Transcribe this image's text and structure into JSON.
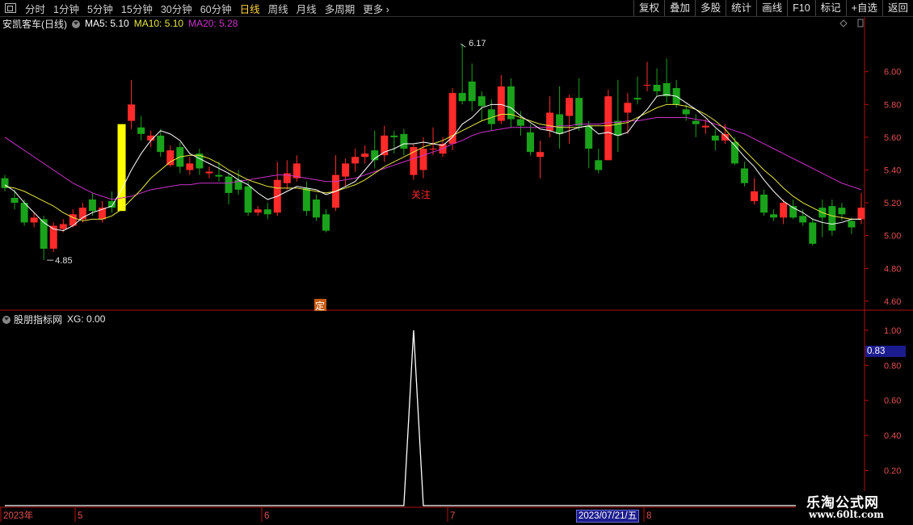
{
  "toolbar": {
    "periods": [
      "分时",
      "1分钟",
      "5分钟",
      "15分钟",
      "30分钟",
      "60分钟",
      "日线",
      "周线",
      "月线",
      "多周期",
      "更多"
    ],
    "active_period": "日线",
    "right_buttons": [
      "复权",
      "叠加",
      "多股",
      "统计",
      "画线",
      "F10",
      "标记",
      "+自选",
      "返回"
    ]
  },
  "title": {
    "stock": "安凯客车(日线)",
    "ma5": "MA5: 5.10",
    "ma10": "MA10: 5.10",
    "ma20": "MA20: 5.28"
  },
  "indicator": {
    "name": "股朋指标网",
    "xg": "XG: 0.00",
    "current_value": "0.83"
  },
  "colors": {
    "up": "#ff2a2a",
    "down": "#1aa31a",
    "ma5": "#ffffff",
    "ma10": "#e6e640",
    "ma20": "#cc33cc",
    "highlight": "#ffff00",
    "axis": "#b01010"
  },
  "annotations": {
    "high": "6.17",
    "low": "4.85",
    "follow": "关注",
    "marker": "定"
  },
  "date_axis": {
    "labels": [
      "2023年",
      "5",
      "6",
      "7",
      "8"
    ],
    "cursor_date": "2023/07/21/五"
  },
  "watermark": {
    "line1": "乐淘公式网",
    "line2": "www.60lt.com"
  },
  "chart_data": [
    {
      "type": "candlestick",
      "title": "安凯客车(日线)",
      "ylim": [
        4.55,
        6.25
      ],
      "yticks": [
        4.6,
        4.8,
        5.0,
        5.2,
        5.4,
        5.6,
        5.8,
        6.0
      ],
      "annotated_high": 6.17,
      "annotated_low": 4.85,
      "candles": [
        [
          5.35,
          5.29,
          5.37,
          5.27
        ],
        [
          5.23,
          5.2,
          5.28,
          5.16
        ],
        [
          5.2,
          5.08,
          5.22,
          5.06
        ],
        [
          5.08,
          5.11,
          5.14,
          5.05
        ],
        [
          5.1,
          4.92,
          5.12,
          4.85
        ],
        [
          4.92,
          5.06,
          5.08,
          4.9
        ],
        [
          5.04,
          5.07,
          5.1,
          5.02
        ],
        [
          5.06,
          5.13,
          5.16,
          5.05
        ],
        [
          5.1,
          5.17,
          5.2,
          5.08
        ],
        [
          5.22,
          5.15,
          5.26,
          5.12
        ],
        [
          5.1,
          5.17,
          5.21,
          5.08
        ],
        [
          5.21,
          5.17,
          5.27,
          5.14
        ],
        [
          5.15,
          5.68,
          5.7,
          5.15
        ],
        [
          5.7,
          5.8,
          5.95,
          5.65
        ],
        [
          5.66,
          5.62,
          5.73,
          5.58
        ],
        [
          5.58,
          5.61,
          5.64,
          5.54
        ],
        [
          5.61,
          5.51,
          5.65,
          5.48
        ],
        [
          5.43,
          5.52,
          5.55,
          5.42
        ],
        [
          5.54,
          5.42,
          5.57,
          5.38
        ],
        [
          5.4,
          5.44,
          5.48,
          5.37
        ],
        [
          5.5,
          5.41,
          5.53,
          5.37
        ],
        [
          5.38,
          5.39,
          5.42,
          5.35
        ],
        [
          5.37,
          5.36,
          5.45,
          5.33
        ],
        [
          5.36,
          5.26,
          5.38,
          5.19
        ],
        [
          5.34,
          5.28,
          5.4,
          5.25
        ],
        [
          5.3,
          5.14,
          5.33,
          5.12
        ],
        [
          5.14,
          5.16,
          5.18,
          5.12
        ],
        [
          5.16,
          5.13,
          5.2,
          5.1
        ],
        [
          5.14,
          5.34,
          5.45,
          5.12
        ],
        [
          5.32,
          5.38,
          5.46,
          5.28
        ],
        [
          5.35,
          5.44,
          5.49,
          5.33
        ],
        [
          5.29,
          5.15,
          5.33,
          5.12
        ],
        [
          5.22,
          5.11,
          5.25,
          5.09
        ],
        [
          5.13,
          5.03,
          5.16,
          5.02
        ],
        [
          5.17,
          5.37,
          5.49,
          5.15
        ],
        [
          5.36,
          5.44,
          5.47,
          5.3
        ],
        [
          5.44,
          5.48,
          5.53,
          5.39
        ],
        [
          5.48,
          5.5,
          5.55,
          5.44
        ],
        [
          5.52,
          5.46,
          5.64,
          5.41
        ],
        [
          5.49,
          5.61,
          5.67,
          5.45
        ],
        [
          5.61,
          5.6,
          5.64,
          5.5
        ],
        [
          5.62,
          5.53,
          5.65,
          5.49
        ],
        [
          5.37,
          5.54,
          5.56,
          5.34
        ],
        [
          5.4,
          5.53,
          5.6,
          5.35
        ],
        [
          5.53,
          5.53,
          5.66,
          5.49
        ],
        [
          5.5,
          5.56,
          5.6,
          5.48
        ],
        [
          5.56,
          5.87,
          5.9,
          5.52
        ],
        [
          5.87,
          5.82,
          6.17,
          5.8
        ],
        [
          5.94,
          5.82,
          6.05,
          5.76
        ],
        [
          5.85,
          5.79,
          5.88,
          5.7
        ],
        [
          5.77,
          5.68,
          5.83,
          5.64
        ],
        [
          5.7,
          5.91,
          5.98,
          5.68
        ],
        [
          5.91,
          5.71,
          5.96,
          5.66
        ],
        [
          5.71,
          5.67,
          5.76,
          5.61
        ],
        [
          5.63,
          5.51,
          5.68,
          5.49
        ],
        [
          5.48,
          5.51,
          5.58,
          5.35
        ],
        [
          5.64,
          5.75,
          5.85,
          5.6
        ],
        [
          5.74,
          5.62,
          5.91,
          5.53
        ],
        [
          5.73,
          5.84,
          5.86,
          5.56
        ],
        [
          5.84,
          5.67,
          5.96,
          5.64
        ],
        [
          5.67,
          5.53,
          5.7,
          5.41
        ],
        [
          5.46,
          5.4,
          5.53,
          5.38
        ],
        [
          5.46,
          5.85,
          5.89,
          5.46
        ],
        [
          5.7,
          5.61,
          5.95,
          5.51
        ],
        [
          5.75,
          5.81,
          5.87,
          5.62
        ],
        [
          5.84,
          5.83,
          5.97,
          5.8
        ],
        [
          5.92,
          5.92,
          6.06,
          5.88
        ],
        [
          5.92,
          5.88,
          6.02,
          5.85
        ],
        [
          5.93,
          5.85,
          6.08,
          5.81
        ],
        [
          5.9,
          5.8,
          5.95,
          5.78
        ],
        [
          5.77,
          5.74,
          5.8,
          5.7
        ],
        [
          5.7,
          5.68,
          5.74,
          5.6
        ],
        [
          5.66,
          5.67,
          5.71,
          5.62
        ],
        [
          5.61,
          5.58,
          5.65,
          5.52
        ],
        [
          5.58,
          5.62,
          5.68,
          5.56
        ],
        [
          5.57,
          5.44,
          5.6,
          5.43
        ],
        [
          5.41,
          5.32,
          5.45,
          5.3
        ],
        [
          5.21,
          5.27,
          5.35,
          5.19
        ],
        [
          5.25,
          5.14,
          5.28,
          5.12
        ],
        [
          5.13,
          5.11,
          5.16,
          5.09
        ],
        [
          5.11,
          5.2,
          5.22,
          5.07
        ],
        [
          5.18,
          5.11,
          5.22,
          5.1
        ],
        [
          5.12,
          5.08,
          5.16,
          5.06
        ],
        [
          5.08,
          4.95,
          5.1,
          4.94
        ],
        [
          5.17,
          5.11,
          5.22,
          4.99
        ],
        [
          5.18,
          5.03,
          5.22,
          5.0
        ],
        [
          5.17,
          5.13,
          5.2,
          5.09
        ],
        [
          5.09,
          5.05,
          5.11,
          5.01
        ],
        [
          5.1,
          5.17,
          5.26,
          5.07
        ]
      ],
      "ma5": [
        5.31,
        5.27,
        5.2,
        5.14,
        5.08,
        5.04,
        5.03,
        5.06,
        5.11,
        5.14,
        5.16,
        5.18,
        5.28,
        5.4,
        5.5,
        5.58,
        5.64,
        5.62,
        5.58,
        5.5,
        5.47,
        5.44,
        5.41,
        5.38,
        5.34,
        5.31,
        5.26,
        5.22,
        5.24,
        5.27,
        5.3,
        5.29,
        5.28,
        5.25,
        5.27,
        5.3,
        5.33,
        5.4,
        5.47,
        5.51,
        5.53,
        5.56,
        5.56,
        5.57,
        5.56,
        5.55,
        5.6,
        5.68,
        5.72,
        5.78,
        5.8,
        5.8,
        5.78,
        5.73,
        5.69,
        5.65,
        5.64,
        5.62,
        5.64,
        5.66,
        5.67,
        5.62,
        5.63,
        5.61,
        5.63,
        5.71,
        5.77,
        5.85,
        5.86,
        5.85,
        5.81,
        5.77,
        5.72,
        5.66,
        5.61,
        5.55,
        5.48,
        5.42,
        5.34,
        5.27,
        5.21,
        5.17,
        5.14,
        5.1,
        5.08,
        5.07,
        5.08,
        5.1,
        5.1
      ],
      "ma10": [
        5.3,
        5.29,
        5.27,
        5.24,
        5.21,
        5.18,
        5.14,
        5.11,
        5.09,
        5.1,
        5.1,
        5.12,
        5.16,
        5.22,
        5.28,
        5.35,
        5.4,
        5.45,
        5.48,
        5.49,
        5.49,
        5.47,
        5.44,
        5.4,
        5.37,
        5.34,
        5.32,
        5.3,
        5.29,
        5.29,
        5.29,
        5.28,
        5.27,
        5.26,
        5.27,
        5.29,
        5.31,
        5.34,
        5.38,
        5.42,
        5.45,
        5.48,
        5.51,
        5.54,
        5.56,
        5.58,
        5.61,
        5.64,
        5.67,
        5.7,
        5.72,
        5.74,
        5.74,
        5.72,
        5.7,
        5.68,
        5.67,
        5.66,
        5.66,
        5.66,
        5.67,
        5.67,
        5.67,
        5.68,
        5.69,
        5.72,
        5.75,
        5.78,
        5.8,
        5.8,
        5.79,
        5.77,
        5.74,
        5.7,
        5.65,
        5.58,
        5.52,
        5.46,
        5.4,
        5.35,
        5.29,
        5.24,
        5.2,
        5.17,
        5.14,
        5.12,
        5.11,
        5.1,
        5.1
      ],
      "ma20": [
        5.6,
        5.56,
        5.52,
        5.48,
        5.44,
        5.4,
        5.36,
        5.32,
        5.29,
        5.26,
        5.24,
        5.22,
        5.23,
        5.24,
        5.26,
        5.28,
        5.29,
        5.3,
        5.31,
        5.31,
        5.32,
        5.32,
        5.32,
        5.32,
        5.33,
        5.34,
        5.35,
        5.36,
        5.37,
        5.37,
        5.36,
        5.35,
        5.34,
        5.33,
        5.33,
        5.34,
        5.35,
        5.37,
        5.39,
        5.41,
        5.43,
        5.45,
        5.47,
        5.49,
        5.51,
        5.53,
        5.56,
        5.58,
        5.61,
        5.63,
        5.64,
        5.65,
        5.66,
        5.66,
        5.66,
        5.66,
        5.66,
        5.67,
        5.67,
        5.68,
        5.68,
        5.68,
        5.69,
        5.69,
        5.7,
        5.7,
        5.71,
        5.72,
        5.72,
        5.72,
        5.72,
        5.71,
        5.7,
        5.68,
        5.66,
        5.64,
        5.62,
        5.59,
        5.56,
        5.53,
        5.5,
        5.47,
        5.44,
        5.41,
        5.38,
        5.35,
        5.32,
        5.3,
        5.28
      ]
    },
    {
      "type": "line",
      "title": "股朋指标网",
      "ylim": [
        0,
        1.05
      ],
      "yticks": [
        0.2,
        0.4,
        0.6,
        0.8,
        1.0
      ],
      "spike_index": 42,
      "spike_value": 1.0,
      "baseline": 0.0
    }
  ]
}
